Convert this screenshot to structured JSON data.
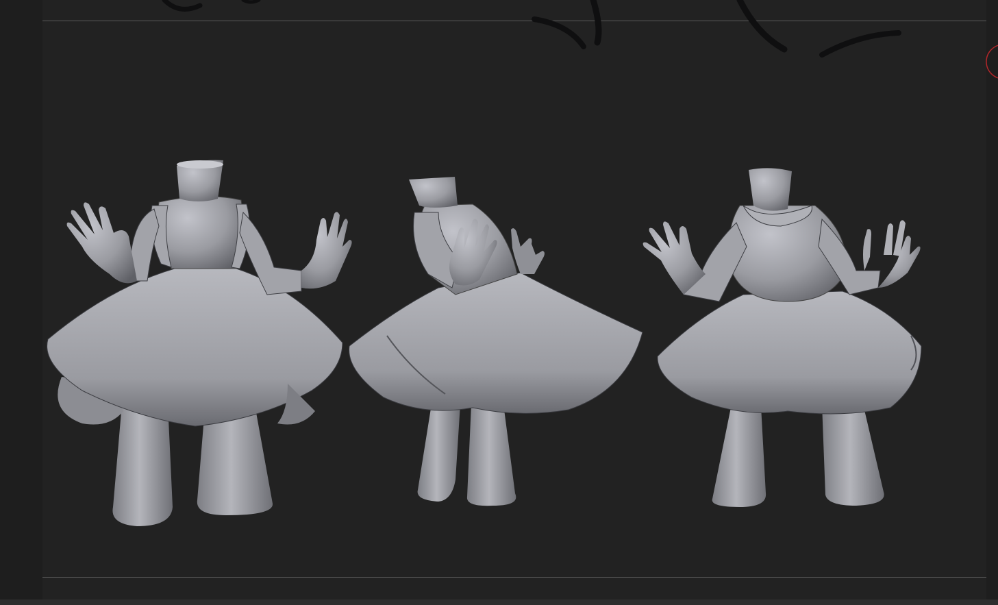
{
  "app": {
    "viewport": {
      "background": "#222222",
      "frame_line_color": "#5a5a5a",
      "model_color": "#9b9ca2"
    },
    "icons": {
      "hud_icon": "circle-icon",
      "hud_icon_color": "#b3262a"
    },
    "models": [
      {
        "id": "figure-front"
      },
      {
        "id": "figure-side"
      },
      {
        "id": "figure-back"
      }
    ]
  }
}
